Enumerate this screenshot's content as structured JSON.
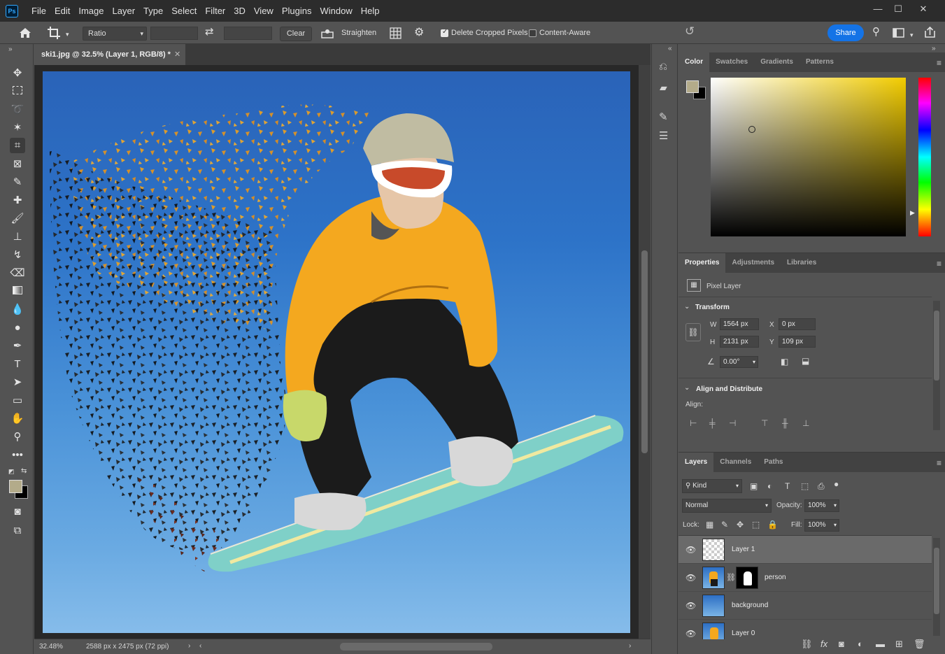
{
  "app": {
    "logo": "Ps",
    "menu": [
      "File",
      "Edit",
      "Image",
      "Layer",
      "Type",
      "Select",
      "Filter",
      "3D",
      "View",
      "Plugins",
      "Window",
      "Help"
    ]
  },
  "options_bar": {
    "ratio_label": "Ratio",
    "clear_label": "Clear",
    "straighten_label": "Straighten",
    "delete_cropped_label": "Delete Cropped Pixels",
    "delete_cropped_checked": true,
    "content_aware_label": "Content-Aware",
    "content_aware_checked": false,
    "share_label": "Share"
  },
  "document": {
    "tab_title": "ski1.jpg @ 32.5% (Layer 1, RGB/8) *",
    "zoom": "32.48%",
    "dimensions": "2588 px x 2475 px (72 ppi)"
  },
  "color_panel": {
    "tabs": [
      "Color",
      "Swatches",
      "Gradients",
      "Patterns"
    ],
    "foreground": "#b3ab8a",
    "background": "#000000",
    "hue_color": "#f2cc00"
  },
  "properties_panel": {
    "tabs": [
      "Properties",
      "Adjustments",
      "Libraries"
    ],
    "layer_type": "Pixel Layer",
    "transform_title": "Transform",
    "w_label": "W",
    "w_value": "1564 px",
    "h_label": "H",
    "h_value": "2131 px",
    "x_label": "X",
    "x_value": "0 px",
    "y_label": "Y",
    "y_value": "109 px",
    "angle_value": "0.00°",
    "align_title": "Align and Distribute",
    "align_label": "Align:"
  },
  "layers_panel": {
    "tabs": [
      "Layers",
      "Channels",
      "Paths"
    ],
    "filter_kind": "Kind",
    "blend_mode": "Normal",
    "opacity_label": "Opacity:",
    "opacity_value": "100%",
    "lock_label": "Lock:",
    "fill_label": "Fill:",
    "fill_value": "100%",
    "layers": [
      {
        "name": "Layer 1",
        "selected": true
      },
      {
        "name": "person",
        "selected": false
      },
      {
        "name": "background",
        "selected": false
      },
      {
        "name": "Layer 0",
        "selected": false
      }
    ]
  }
}
